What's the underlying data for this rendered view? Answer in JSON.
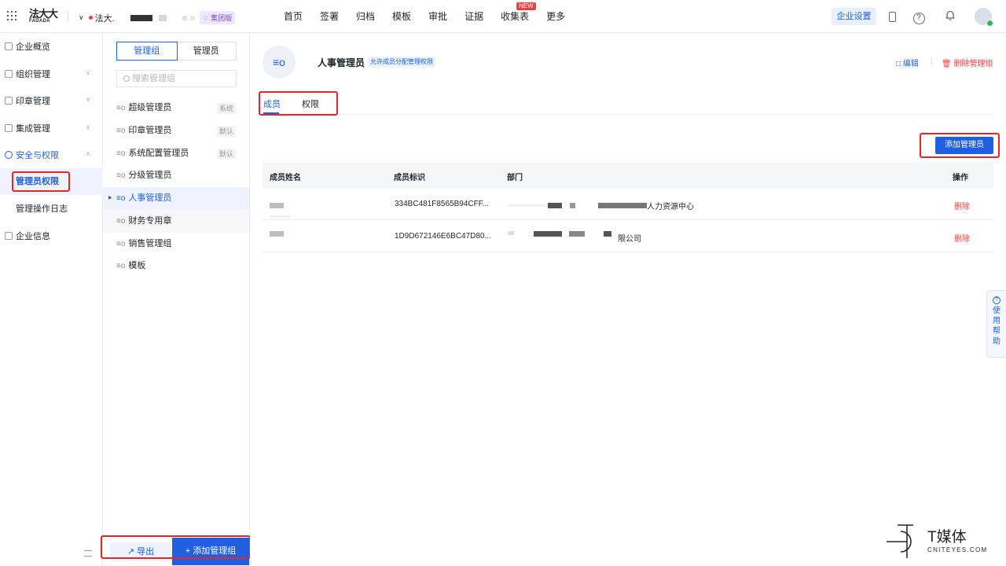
{
  "topbar": {
    "logo_cn": "法大大",
    "logo_en": "FADADA",
    "company_name": "法大.",
    "group_badge": "集团版",
    "nav": [
      "首页",
      "签署",
      "归档",
      "模板",
      "审批",
      "证据",
      "收集表",
      "更多"
    ],
    "new_badge": "NEW",
    "enterprise_settings": "企业设置"
  },
  "sidebar": {
    "items": [
      {
        "label": "企业概览"
      },
      {
        "label": "组织管理"
      },
      {
        "label": "印章管理"
      },
      {
        "label": "集成管理"
      },
      {
        "label": "安全与权限"
      }
    ],
    "subitems": [
      "管理员权限",
      "管理操作日志"
    ],
    "last_item": "企业信息"
  },
  "groups": {
    "seg_group": "管理组",
    "seg_admin": "管理员",
    "search_placeholder": "搜索管理组",
    "list": [
      {
        "name": "超级管理员",
        "tag": "系统"
      },
      {
        "name": "印章管理员",
        "tag": "默认"
      },
      {
        "name": "系统配置管理员",
        "tag": "默认"
      },
      {
        "name": "分级管理员",
        "tag": ""
      },
      {
        "name": "人事管理员",
        "tag": ""
      },
      {
        "name": "财务专用章",
        "tag": ""
      },
      {
        "name": "销售管理组",
        "tag": ""
      },
      {
        "name": "模板",
        "tag": ""
      }
    ],
    "export_label": "导出",
    "add_group_label": "+ 添加管理组"
  },
  "main": {
    "group_title": "人事管理员",
    "perm_badge": "允许成员分配管理权限",
    "edit_label": "编辑",
    "delete_group_label": "删除管理组",
    "tabs": [
      "成员",
      "权限"
    ],
    "add_admin_label": "添加管理员",
    "columns": [
      "成员姓名",
      "成员标识",
      "部门",
      "操作"
    ],
    "rows": [
      {
        "id": "334BC481F8565B94CFF...",
        "dept": "人力资源中心",
        "action": "删除"
      },
      {
        "id": "1D9D672146E6BC47D80...",
        "dept": "限公司",
        "action": "删除"
      }
    ]
  },
  "help_float": "使用帮助",
  "watermark": {
    "cn": "T媒体",
    "en": "CNITEYES.COM"
  }
}
